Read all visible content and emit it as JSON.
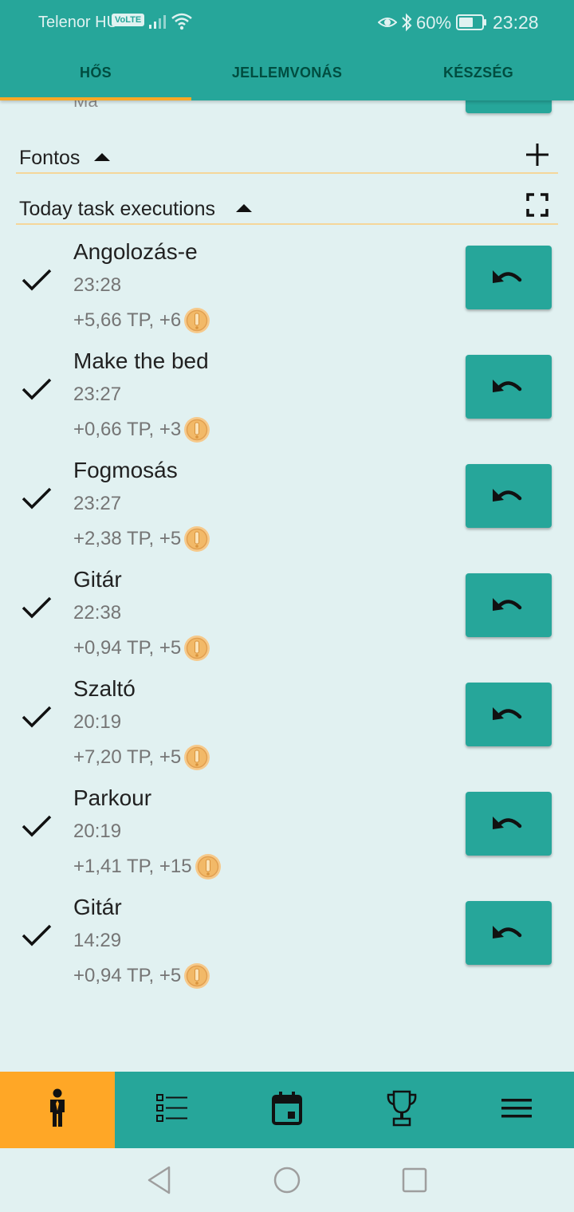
{
  "status_bar": {
    "carrier": "Telenor HU",
    "volte": "VoLTE",
    "battery_percent": "60%",
    "time": "23:28"
  },
  "tabs": [
    {
      "label": "HŐS",
      "active": true
    },
    {
      "label": "JELLEMVONÁS",
      "active": false
    },
    {
      "label": "KÉSZSÉG",
      "active": false
    }
  ],
  "partial_above": {
    "text": "Ma"
  },
  "sections": {
    "important": {
      "title": "Fontos",
      "action_icon": "plus-icon"
    },
    "today": {
      "title": "Today task executions",
      "action_icon": "fullscreen-icon"
    }
  },
  "executions": [
    {
      "name": "Angolozás-e",
      "time": "23:28",
      "reward": "+5,66 TP, +6"
    },
    {
      "name": "Make the bed",
      "time": "23:27",
      "reward": "+0,66 TP, +3"
    },
    {
      "name": "Fogmosás",
      "time": "23:27",
      "reward": "+2,38 TP, +5"
    },
    {
      "name": "Gitár",
      "time": "22:38",
      "reward": "+0,94 TP, +5"
    },
    {
      "name": "Szaltó",
      "time": "20:19",
      "reward": "+7,20 TP, +5"
    },
    {
      "name": "Parkour",
      "time": "20:19",
      "reward": "+1,41 TP, +15"
    },
    {
      "name": "Gitár",
      "time": "14:29",
      "reward": "+0,94 TP, +5"
    }
  ],
  "bottom_nav": [
    {
      "icon": "hero-person-icon",
      "active": true
    },
    {
      "icon": "task-list-icon",
      "active": false
    },
    {
      "icon": "calendar-icon",
      "active": false
    },
    {
      "icon": "trophy-icon",
      "active": false
    },
    {
      "icon": "menu-icon",
      "active": false
    }
  ],
  "colors": {
    "primary": "#26a69a",
    "accent": "#ffa726",
    "tab_indicator": "#f9a825",
    "background": "#e1f1f1"
  }
}
